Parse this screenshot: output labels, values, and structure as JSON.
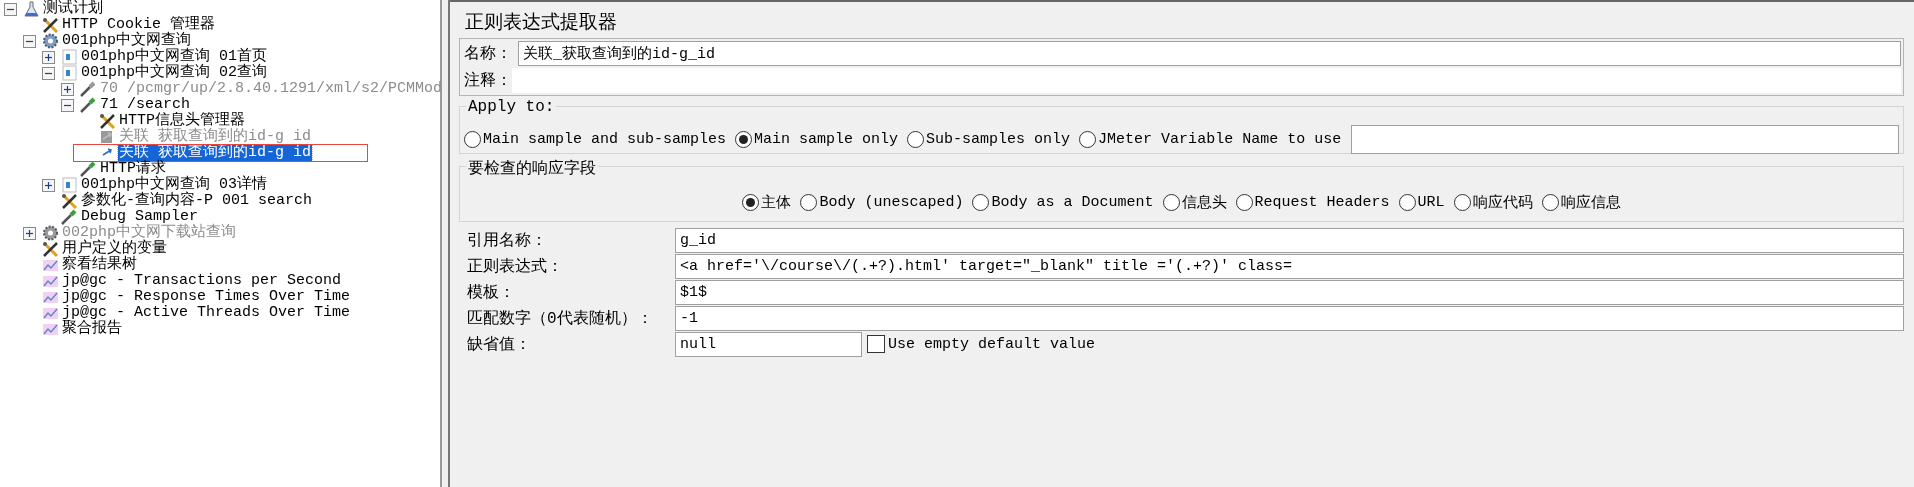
{
  "tree": [
    {
      "label": "测试计划",
      "kind": "plan",
      "expanded": true,
      "selected": false,
      "disabled": false,
      "children": [
        {
          "label": "HTTP Cookie 管理器",
          "kind": "config",
          "selected": false,
          "disabled": false
        },
        {
          "label": "001php中文网查询",
          "kind": "thread_group",
          "expanded": true,
          "selected": false,
          "disabled": false,
          "children": [
            {
              "label": "001php中文网查询 01首页",
              "kind": "controller",
              "expanded": false,
              "selected": false,
              "disabled": false
            },
            {
              "label": "001php中文网查询 02查询",
              "kind": "controller",
              "expanded": true,
              "selected": false,
              "disabled": false,
              "children": [
                {
                  "label": "70 /pcmgr/up/2.8.40.1291/xml/s2/PCMMod",
                  "kind": "sampler",
                  "expanded": false,
                  "selected": false,
                  "disabled": true
                },
                {
                  "label": "71 /search",
                  "kind": "sampler",
                  "expanded": true,
                  "selected": false,
                  "disabled": false,
                  "children": [
                    {
                      "label": "HTTP信息头管理器",
                      "kind": "config",
                      "selected": false,
                      "disabled": false
                    },
                    {
                      "label": "关联 获取查询到的id-g id",
                      "kind": "extractor",
                      "selected": false,
                      "disabled": true
                    },
                    {
                      "label": "关联 获取查询到的id-g id",
                      "kind": "extractor",
                      "selected": true,
                      "disabled": false,
                      "highlighted": true
                    }
                  ]
                },
                {
                  "label": "HTTP请求",
                  "kind": "sampler",
                  "selected": false,
                  "disabled": false
                }
              ]
            },
            {
              "label": "001php中文网查询 03详情",
              "kind": "controller",
              "expanded": false,
              "selected": false,
              "disabled": false
            },
            {
              "label": "参数化-查询内容-P 001 search",
              "kind": "config",
              "selected": false,
              "disabled": false
            },
            {
              "label": "Debug Sampler",
              "kind": "sampler",
              "selected": false,
              "disabled": false
            }
          ]
        },
        {
          "label": "002php中文网下载站查询",
          "kind": "thread_group",
          "expanded": false,
          "selected": false,
          "disabled": true
        },
        {
          "label": "用户定义的变量",
          "kind": "config",
          "selected": false,
          "disabled": false
        },
        {
          "label": "察看结果树",
          "kind": "listener",
          "selected": false,
          "disabled": false
        },
        {
          "label": "jp@gc - Transactions per Second",
          "kind": "listener",
          "selected": false,
          "disabled": false
        },
        {
          "label": "jp@gc - Response Times Over Time",
          "kind": "listener",
          "selected": false,
          "disabled": false
        },
        {
          "label": "jp@gc - Active Threads Over Time",
          "kind": "listener",
          "selected": false,
          "disabled": false
        },
        {
          "label": "聚合报告",
          "kind": "listener",
          "selected": false,
          "disabled": false
        }
      ]
    }
  ],
  "editor": {
    "title": "正则表达式提取器",
    "name": {
      "label": "名称：",
      "value": "关联_获取查询到的id-g_id"
    },
    "comment": {
      "label": "注释："
    },
    "apply_to": {
      "title": "Apply to:",
      "options": [
        {
          "label": "Main sample and sub-samples",
          "selected": false
        },
        {
          "label": "Main sample only",
          "selected": true
        },
        {
          "label": "Sub-samples only",
          "selected": false
        },
        {
          "label": "JMeter Variable Name to use",
          "selected": false
        }
      ]
    },
    "response_field": {
      "title": "要检查的响应字段",
      "options": [
        {
          "label": "主体",
          "selected": true
        },
        {
          "label": "Body (unescaped)",
          "selected": false
        },
        {
          "label": "Body as a Document",
          "selected": false
        },
        {
          "label": "信息头",
          "selected": false
        },
        {
          "label": "Request Headers",
          "selected": false
        },
        {
          "label": "URL",
          "selected": false
        },
        {
          "label": "响应代码",
          "selected": false
        },
        {
          "label": "响应信息",
          "selected": false
        }
      ]
    },
    "fields": [
      {
        "label": "引用名称：",
        "value": "g_id"
      },
      {
        "label": "正则表达式：",
        "value": "<a href='\\/course\\/(.+?).html' target=\"_blank\" title ='(.+?)' class="
      },
      {
        "label": "模板：",
        "value": "$1$"
      },
      {
        "label": "匹配数字（0代表随机）：",
        "value": "-1"
      },
      {
        "label": "缺省值：",
        "value": "null",
        "checkbox": {
          "label": "Use empty default value",
          "checked": false
        }
      }
    ]
  }
}
